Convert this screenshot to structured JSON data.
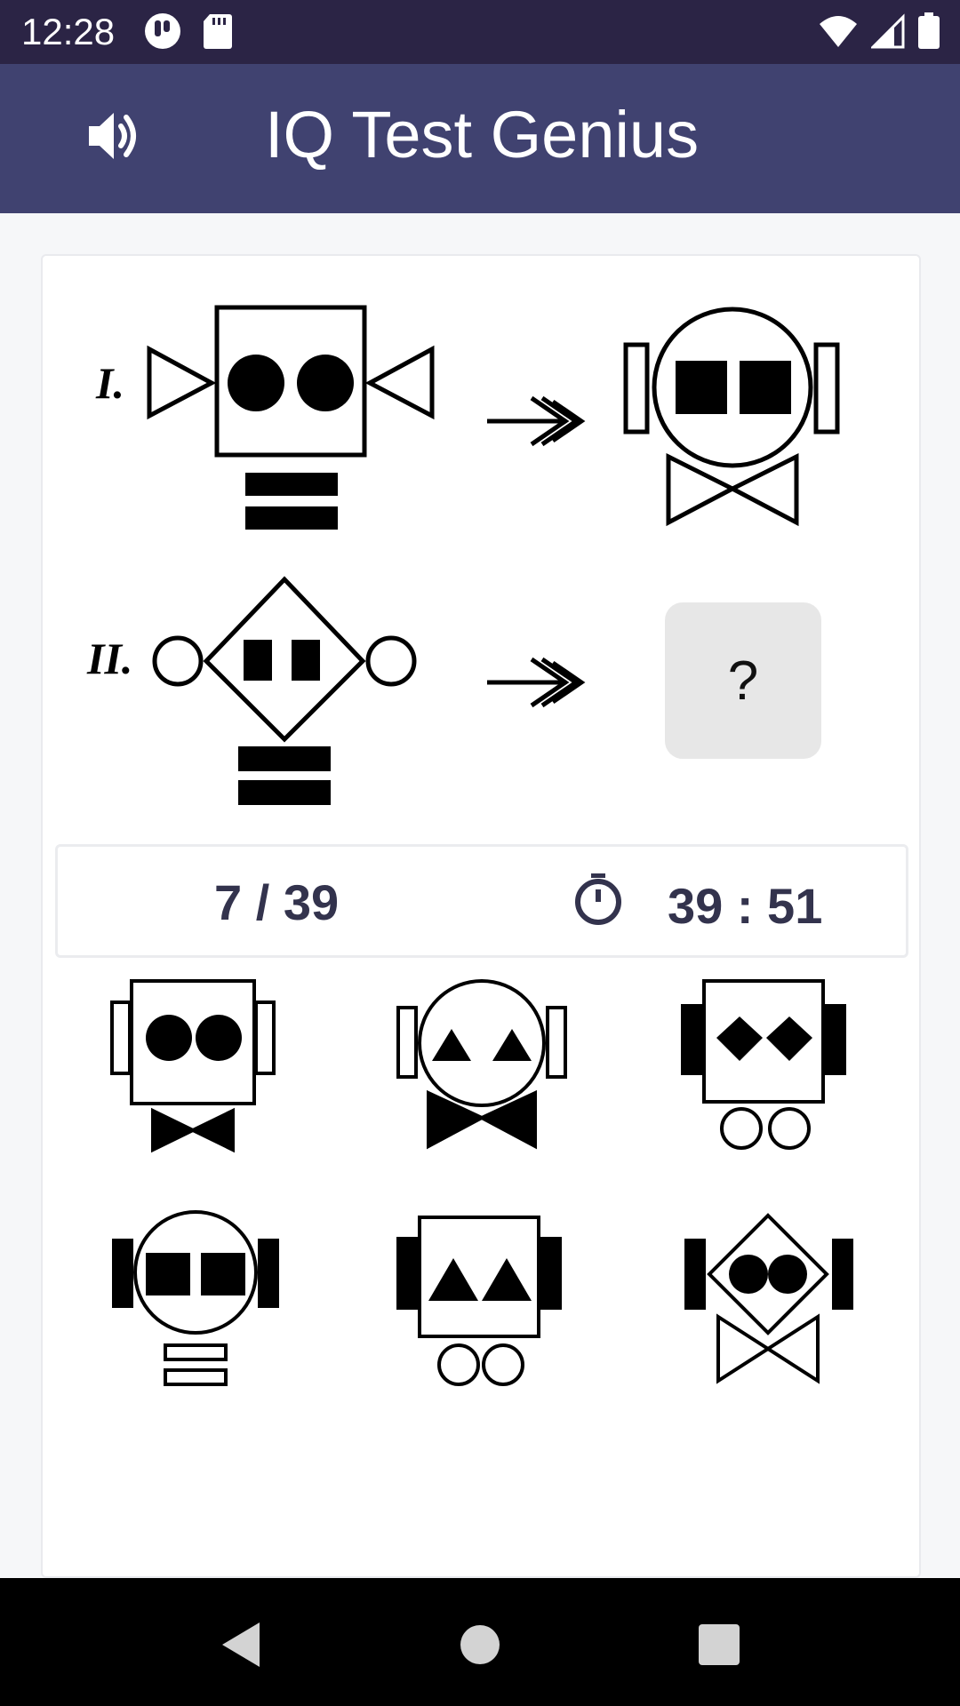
{
  "status_bar": {
    "time": "12:28",
    "left_icons": [
      "app-notification-icon",
      "sd-card-icon"
    ],
    "right_icons": [
      "wifi-icon",
      "cell-signal-icon",
      "battery-icon"
    ]
  },
  "app_bar": {
    "title": "IQ Test Genius",
    "sound_icon": "volume-icon"
  },
  "question": {
    "row1_label": "I.",
    "row2_label": "II.",
    "arrow_icon": "triple-arrow-icon",
    "unknown": "?"
  },
  "info": {
    "progress": "7 / 39",
    "timer_icon": "stopwatch-icon",
    "timer": "39 : 51"
  },
  "options": [
    {
      "id": 1,
      "description": "square-face-circles-eyes-bowtie"
    },
    {
      "id": 2,
      "description": "circle-face-triangle-eyes-bowtie"
    },
    {
      "id": 3,
      "description": "square-face-diamond-eyes-wheels"
    },
    {
      "id": 4,
      "description": "circle-face-square-eyes-bars"
    },
    {
      "id": 5,
      "description": "square-face-triangle-eyes-wheels"
    },
    {
      "id": 6,
      "description": "diamond-face-circle-eyes-bowtie"
    }
  ],
  "nav_bar": {
    "back": "back-icon",
    "home": "home-icon",
    "recents": "recents-icon"
  }
}
